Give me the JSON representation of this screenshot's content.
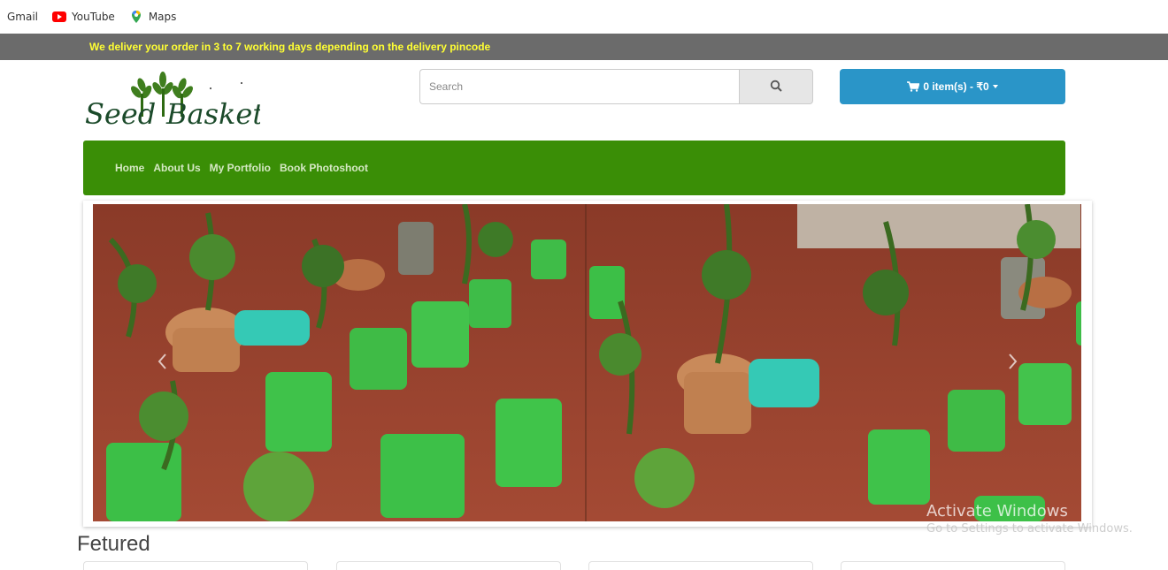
{
  "bookmarks": [
    {
      "label": "Gmail",
      "icon": "gmail-icon"
    },
    {
      "label": "YouTube",
      "icon": "youtube-icon"
    },
    {
      "label": "Maps",
      "icon": "maps-icon"
    }
  ],
  "announcement": "We deliver your order in 3 to 7 working days depending on the delivery pincode",
  "logo": {
    "text_left": "Seed",
    "text_right": "Basket"
  },
  "search": {
    "placeholder": "Search",
    "value": ""
  },
  "cart": {
    "label": "0 item(s) - ₹0"
  },
  "nav": [
    "Home",
    "About Us",
    "My Portfolio",
    "Book Photoshoot"
  ],
  "section_title": "Fetured",
  "watermark": {
    "line1": "Activate Windows",
    "line2": "Go to Settings to activate Windows."
  },
  "colors": {
    "nav_bg": "#3a8e06",
    "cart_bg": "#2a95c8",
    "announce_bg": "#6b6b6b",
    "announce_text": "#ffff33"
  }
}
